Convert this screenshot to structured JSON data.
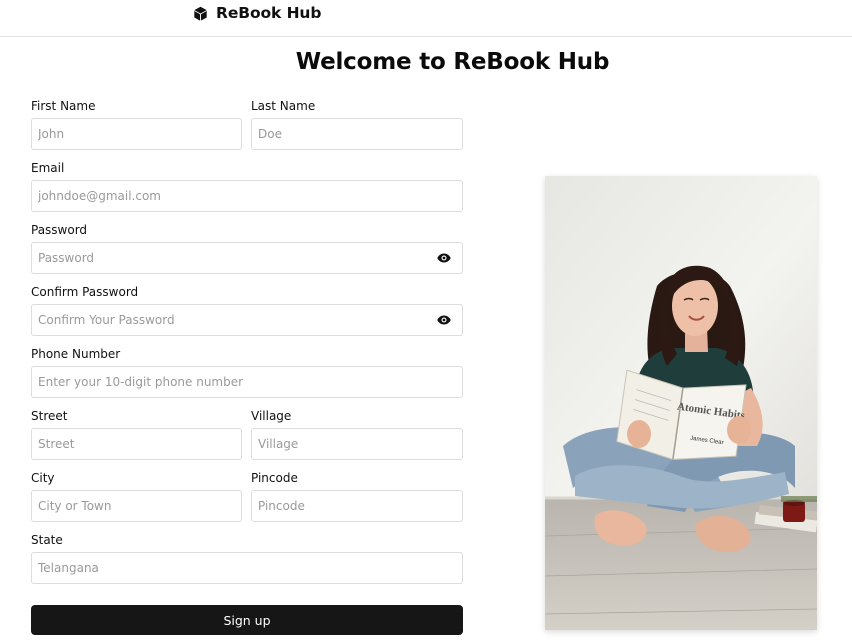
{
  "header": {
    "brand_name": "ReBook Hub",
    "brand_icon": "cube-icon"
  },
  "page": {
    "title": "Welcome to ReBook Hub"
  },
  "form": {
    "first_name": {
      "label": "First Name",
      "placeholder": "John"
    },
    "last_name": {
      "label": "Last Name",
      "placeholder": "Doe"
    },
    "email": {
      "label": "Email",
      "placeholder": "johndoe@gmail.com"
    },
    "password": {
      "label": "Password",
      "placeholder": "Password",
      "toggle_icon": "eye-icon"
    },
    "confirm_password": {
      "label": "Confirm Password",
      "placeholder": "Confirm Your Password",
      "toggle_icon": "eye-icon"
    },
    "phone": {
      "label": "Phone Number",
      "placeholder": "Enter your 10-digit phone number"
    },
    "street": {
      "label": "Street",
      "placeholder": "Street"
    },
    "village": {
      "label": "Village",
      "placeholder": "Village"
    },
    "city": {
      "label": "City",
      "placeholder": "City or Town"
    },
    "pincode": {
      "label": "Pincode",
      "placeholder": "Pincode"
    },
    "state": {
      "label": "State",
      "placeholder": "Telangana"
    },
    "submit_label": "Sign up"
  },
  "hero_image": {
    "book_title": "Atomic Habits",
    "book_author": "James Clear"
  },
  "colors": {
    "button_bg": "#161616",
    "border": "#dcdcdc",
    "placeholder": "#9a9a9a"
  }
}
